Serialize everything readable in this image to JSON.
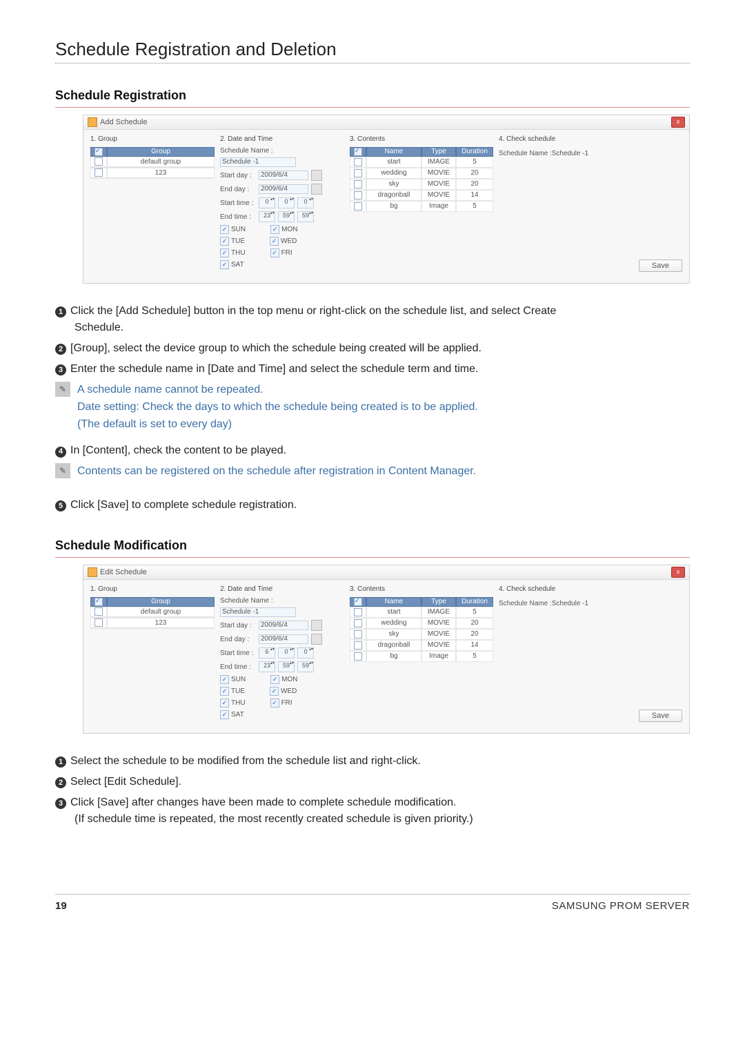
{
  "page": {
    "title": "Schedule Registration and Deletion",
    "section1": "Schedule Registration",
    "section2": "Schedule Modification",
    "pageNumber": "19",
    "brand": "SAMSUNG PROM SERVER"
  },
  "dialogAdd": {
    "title": "Add Schedule",
    "close": "x",
    "col1": {
      "title": "1. Group",
      "header_check": " ",
      "header_group": "Group",
      "rows": [
        {
          "chk": false,
          "name": "default group"
        },
        {
          "chk": false,
          "name": "123"
        }
      ]
    },
    "col2": {
      "title": "2. Date and Time",
      "schedNameLabel": "Schedule Name :",
      "schedName": "Schedule -1",
      "startDayLabel": "Start day :",
      "startDay": "2009/6/4",
      "endDayLabel": "End day :",
      "endDay": "2009/6/4",
      "startTimeLabel": "Start time :",
      "startH": "0",
      "startM": "0",
      "startS": "0",
      "endTimeLabel": "End time :",
      "endH": "23",
      "endM": "59",
      "endS": "59",
      "days": [
        "SUN",
        "MON",
        "TUE",
        "WED",
        "THU",
        "FRI",
        "SAT"
      ]
    },
    "col3": {
      "title": "3. Contents",
      "headers": {
        "name": "Name",
        "type": "Type",
        "dur": "Duration"
      },
      "rows": [
        {
          "chk": false,
          "name": "start",
          "type": "IMAGE",
          "dur": "5"
        },
        {
          "chk": false,
          "name": "wedding",
          "type": "MOVIE",
          "dur": "20"
        },
        {
          "chk": false,
          "name": "sky",
          "type": "MOVIE",
          "dur": "20"
        },
        {
          "chk": false,
          "name": "dragonball",
          "type": "MOVIE",
          "dur": "14"
        },
        {
          "chk": false,
          "name": "bg",
          "type": "Image",
          "dur": "5"
        }
      ]
    },
    "col4": {
      "title": "4. Check schedule",
      "schedName": "Schedule Name :Schedule -1",
      "save": "Save"
    }
  },
  "dialogEdit": {
    "title": "Edit Schedule",
    "startH": "6",
    "startM": "0",
    "startS": "0"
  },
  "stepsReg": {
    "s1a": "Click the [Add Schedule] button in the top menu or right-click on the schedule list, and select Create",
    "s1b": "Schedule.",
    "s2": "[Group], select the device group to which the schedule being created will be applied.",
    "s3": "Enter the schedule name in [Date and Time] and select the schedule term and time.",
    "note1a": "A schedule name cannot be repeated.",
    "note1b": "Date setting: Check the days to which the schedule being created is to be applied.",
    "note1c": "(The default is set to every day)",
    "s4": "In [Content], check the content to be played.",
    "note2": "Contents can be registered on the schedule after registration in Content Manager.",
    "s5": "Click [Save] to complete schedule registration."
  },
  "stepsMod": {
    "s1": "Select the schedule to be modified from the schedule list and right-click.",
    "s2": "Select [Edit Schedule].",
    "s3": "Click [Save] after changes have been made to complete schedule modification.",
    "s3b": "(If schedule time is repeated, the most recently created schedule is given priority.)"
  }
}
